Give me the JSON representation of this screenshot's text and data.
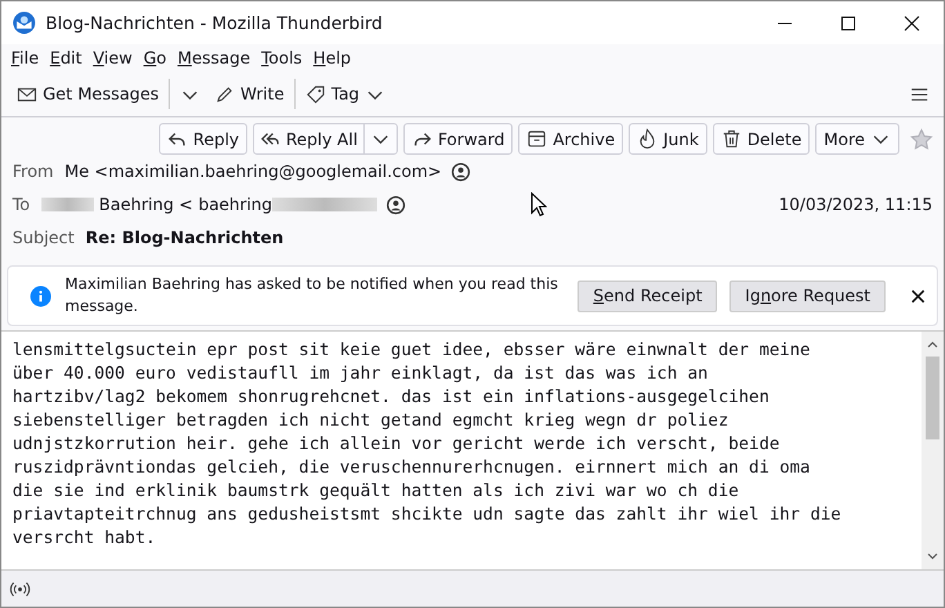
{
  "window": {
    "title": "Blog-Nachrichten - Mozilla Thunderbird"
  },
  "menu": [
    {
      "access_key": "F",
      "rest": "ile"
    },
    {
      "access_key": "E",
      "rest": "dit"
    },
    {
      "access_key": "V",
      "rest": "iew"
    },
    {
      "access_key": "G",
      "rest": "o"
    },
    {
      "access_key": "M",
      "rest": "essage"
    },
    {
      "access_key": "T",
      "rest": "ools"
    },
    {
      "access_key": "H",
      "rest": "elp"
    }
  ],
  "toolbar": [
    {
      "kind": "get",
      "label": "Get Messages"
    },
    {
      "kind": "write",
      "label": "Write"
    },
    {
      "kind": "tag",
      "label": "Tag"
    }
  ],
  "actions": [
    {
      "kind": "reply",
      "label": "Reply"
    },
    {
      "kind": "replyall",
      "label": "Reply All"
    },
    {
      "kind": "forward",
      "label": "Forward"
    },
    {
      "kind": "archive",
      "label": "Archive"
    },
    {
      "kind": "junk",
      "label": "Junk"
    },
    {
      "kind": "delete",
      "label": "Delete"
    },
    {
      "kind": "more",
      "label": "More"
    }
  ],
  "starred": false,
  "header": {
    "from_label": "From",
    "from": "Me <maximilian.baehring@googlemail.com>",
    "to_label": "To",
    "to_name": "Baehring <",
    "to_address": "baehring",
    "date": "10/03/2023, 11:15",
    "subject_label": "Subject",
    "subject": "Re: Blog-Nachrichten"
  },
  "notification": {
    "text": "Maximilian Baehring has asked to be notified when you read this message.",
    "buttons": [
      {
        "access_key": "S",
        "rest": "end Receipt"
      },
      {
        "before": "Ig",
        "access_key": "n",
        "rest": "ore Request"
      }
    ]
  },
  "body": "lensmittelgsuctein epr post sit keie guet idee, ebsser wäre einwnalt der meine\nüber 40.000 euro vedistaufll im jahr einklagt, da ist das was ich an\nhartzibv/lag2 bekomem shonrugrehcnet. das ist ein inflations-ausgegelcihen\nsiebenstelliger betragden ich nicht getand egmcht krieg wegn dr poliez\nudnjstzkorrution heir. gehe ich allein vor gericht werde ich verscht, beide\nruszidprävntiondas gelcieh, die veruschennurerhcnugen. eirnnert mich an di oma\ndie sie ind erklinik baumstrk gequält hatten als ich zivi war wo ch die\npriavtapteitrchnug ans gedusheistsmt shcikte udn sagte das zahlt ihr wiel ihr die\nversrcht habt."
}
